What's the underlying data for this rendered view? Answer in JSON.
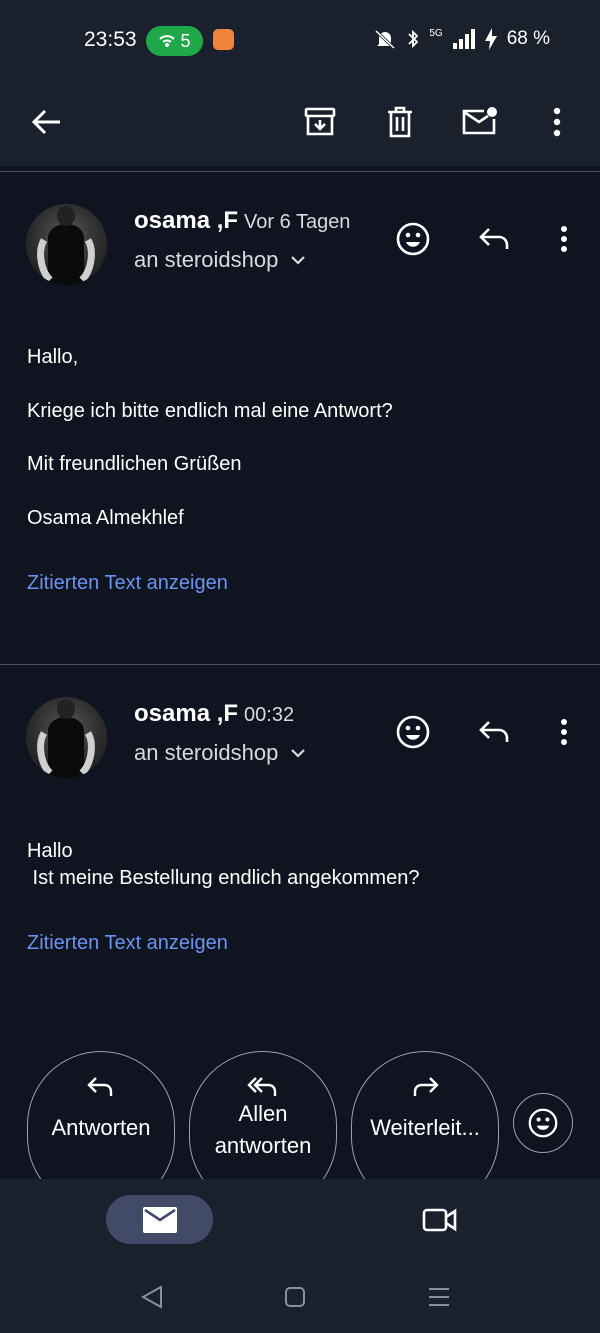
{
  "status_bar": {
    "time": "23:53",
    "hotspot_count": "5",
    "network": "5G",
    "battery": "68 %"
  },
  "toolbar": {
    "back_icon": "arrow-left-icon",
    "archive_icon": "archive-icon",
    "delete_icon": "trash-icon",
    "unread_icon": "mark-unread-icon",
    "more_icon": "more-vert-icon"
  },
  "messages": [
    {
      "sender": "osama ,F",
      "time": "Vor 6 Tagen",
      "recipient": "an steroidshop",
      "body": [
        "Hallo,",
        "Kriege ich bitte endlich mal eine Antwort?",
        "Mit freundlichen Grüßen",
        "Osama Almekhlef"
      ],
      "quoted_link": "Zitierten Text anzeigen"
    },
    {
      "sender": "osama ,F",
      "time": "00:32",
      "recipient": "an steroidshop",
      "body": [
        "Hallo",
        " Ist meine Bestellung endlich angekommen?"
      ],
      "quoted_link": "Zitierten Text anzeigen"
    }
  ],
  "actions": {
    "reply": "Antworten",
    "reply_all_1": "Allen",
    "reply_all_2": "antworten",
    "forward": "Weiterleit..."
  },
  "colors": {
    "background": "#0f1420",
    "bar": "#1b202d",
    "link": "#6b94f0",
    "nav_active": "#414a66",
    "hotspot": "#1fa84a"
  }
}
